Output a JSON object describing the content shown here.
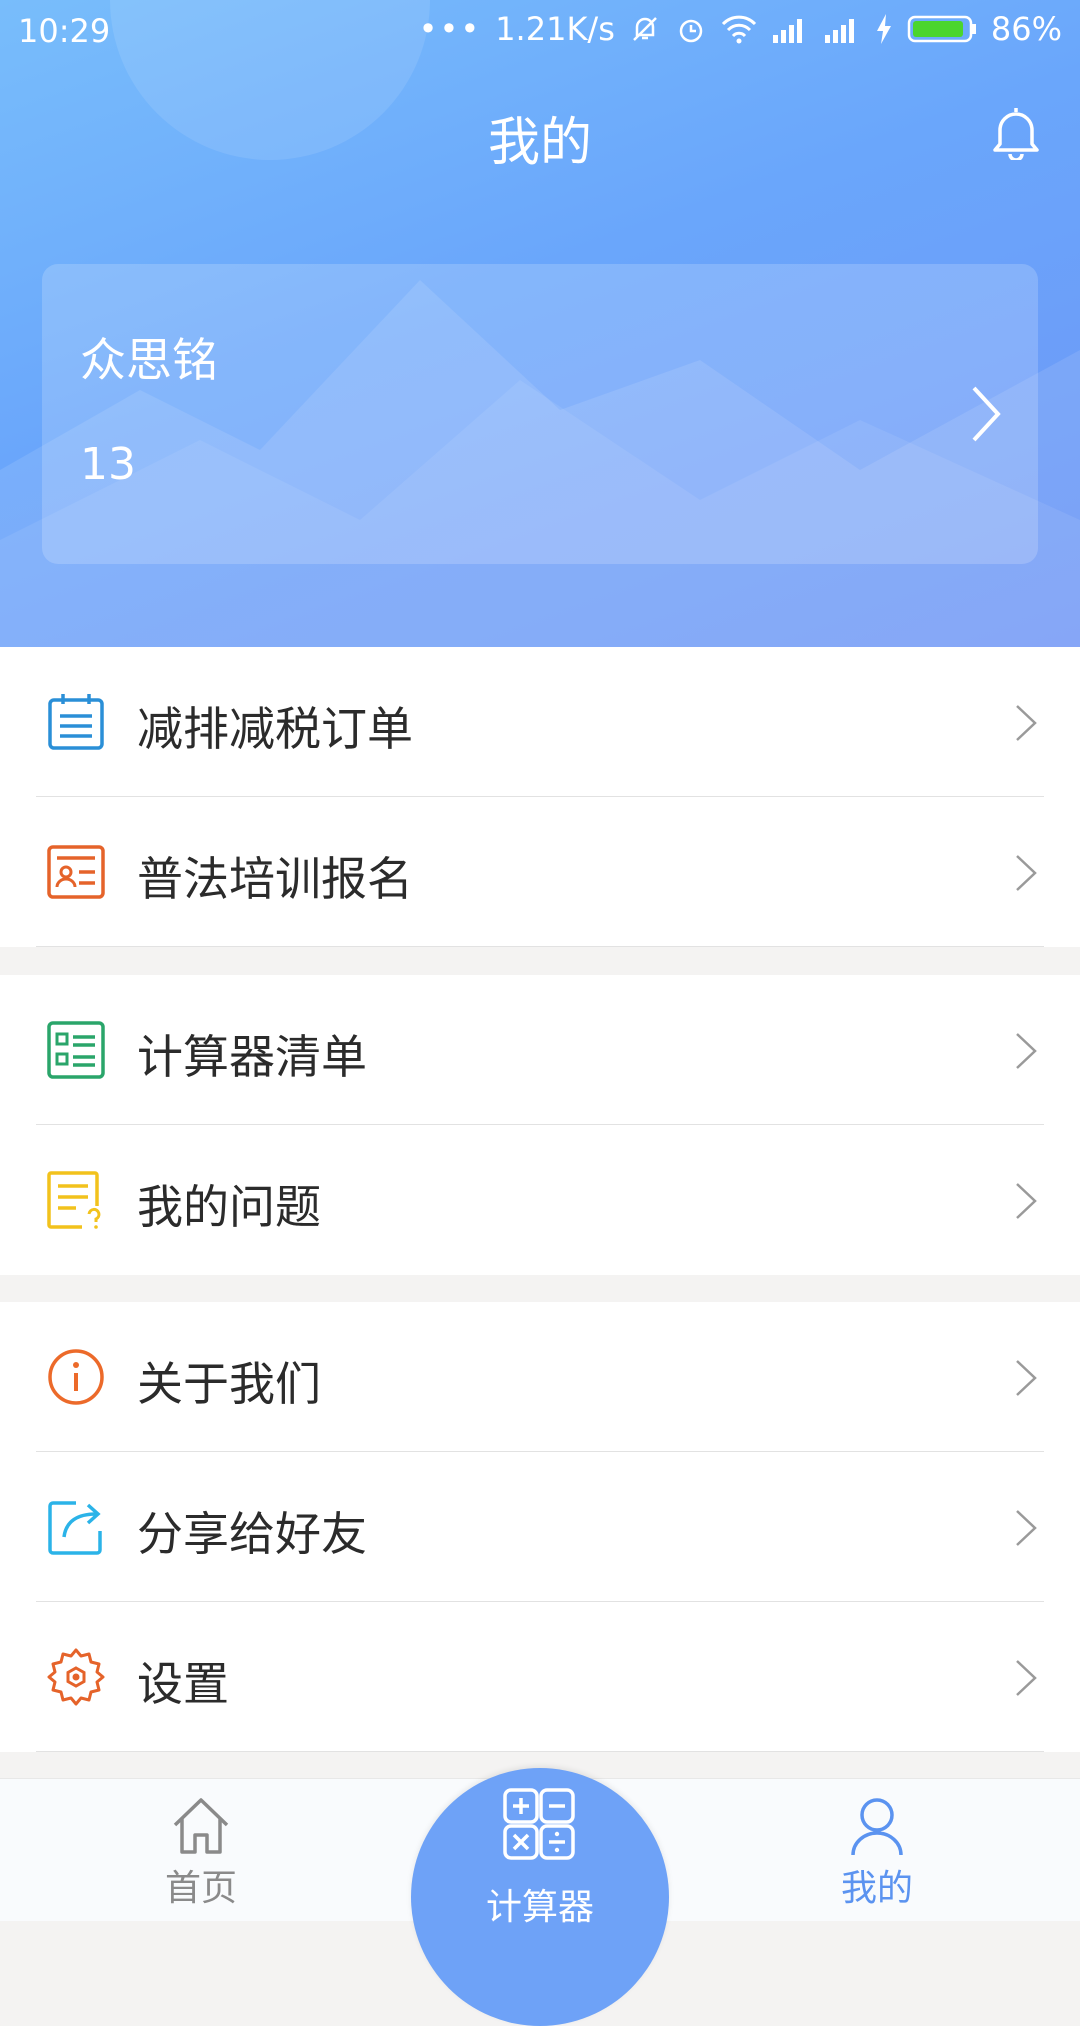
{
  "status_bar": {
    "time": "10:29",
    "speed": "1.21K/s",
    "battery": "86%"
  },
  "header": {
    "title": "我的"
  },
  "profile": {
    "name": "众思铭",
    "id": "13"
  },
  "menu_groups": [
    {
      "items": [
        {
          "label": "减排减税订单",
          "icon": "calendar-list-icon",
          "color": "#2a8fd7"
        },
        {
          "label": "普法培训报名",
          "icon": "id-card-icon",
          "color": "#e5632a"
        }
      ]
    },
    {
      "items": [
        {
          "label": "计算器清单",
          "icon": "checklist-icon",
          "color": "#2aa56a"
        },
        {
          "label": "我的问题",
          "icon": "question-note-icon",
          "color": "#f2c21c"
        }
      ]
    },
    {
      "items": [
        {
          "label": "关于我们",
          "icon": "info-icon",
          "color": "#ec6a2a"
        },
        {
          "label": "分享给好友",
          "icon": "share-icon",
          "color": "#2bb3e8"
        },
        {
          "label": "设置",
          "icon": "gear-icon",
          "color": "#e5632a"
        }
      ]
    }
  ],
  "tabbar": {
    "home": "首页",
    "calculator": "计算器",
    "mine": "我的",
    "active": "mine",
    "active_color": "#5b93f0",
    "inactive_color": "#8a8a8a"
  }
}
